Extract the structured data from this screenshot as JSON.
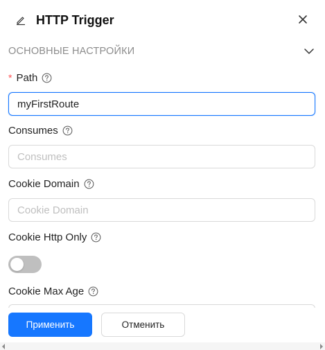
{
  "header": {
    "title": "HTTP Trigger",
    "edit_icon": "edit-icon",
    "close_icon": "close-icon"
  },
  "section": {
    "title": "ОСНОВНЫЕ НАСТРОЙКИ",
    "expanded": true
  },
  "fields": {
    "path": {
      "label": "Path",
      "required": true,
      "value": "myFirstRoute"
    },
    "consumes": {
      "label": "Consumes",
      "placeholder": "Consumes",
      "value": ""
    },
    "cookie_domain": {
      "label": "Cookie Domain",
      "placeholder": "Cookie Domain",
      "value": ""
    },
    "cookie_http_only": {
      "label": "Cookie Http Only",
      "enabled": false
    },
    "cookie_max_age": {
      "label": "Cookie Max Age"
    }
  },
  "footer": {
    "apply_label": "Применить",
    "cancel_label": "Отменить"
  },
  "colors": {
    "primary": "#1677ff",
    "required": "#ff4d4f",
    "toggle_off": "#bfbfbf"
  }
}
